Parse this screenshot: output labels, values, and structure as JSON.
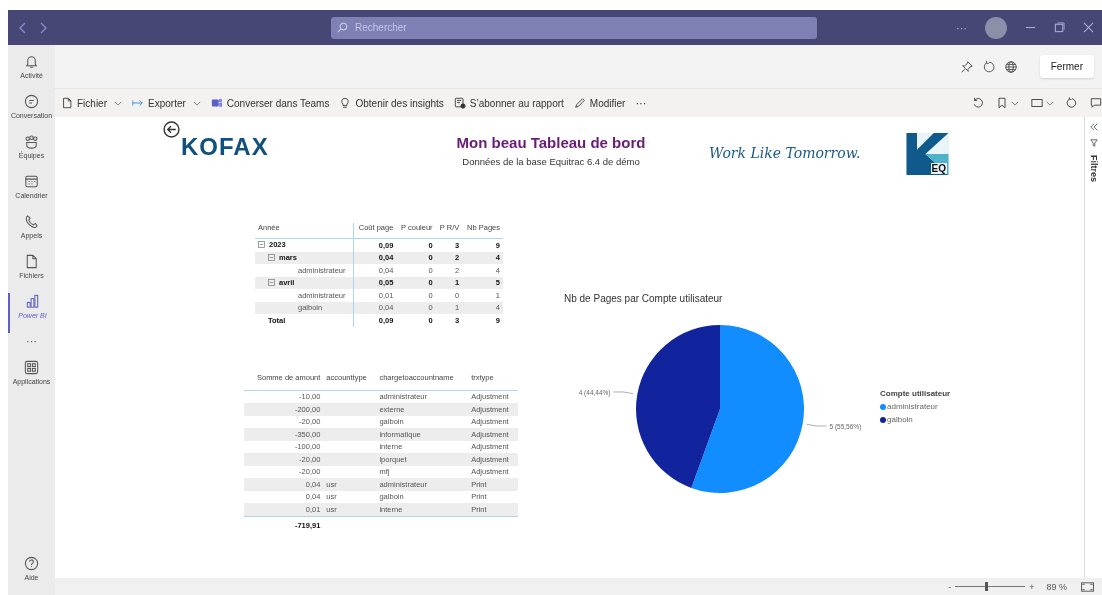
{
  "top_bar": {
    "search": {
      "placeholder": "Rechercher"
    },
    "more": "···"
  },
  "sidebar": {
    "items": [
      {
        "label": "Activité",
        "selected": false
      },
      {
        "label": "Conversation",
        "selected": false
      },
      {
        "label": "Équipes",
        "selected": false
      },
      {
        "label": "Calendrier",
        "selected": false
      },
      {
        "label": "Appels",
        "selected": false
      },
      {
        "label": "Fichiers",
        "selected": false
      },
      {
        "label": "Power BI",
        "selected": true
      }
    ],
    "more": "···",
    "apps": "Applications",
    "help": "Aide"
  },
  "header": {
    "close_button": "Fermer"
  },
  "toolbar": {
    "items": [
      {
        "label": "Fichier",
        "dropdown": true
      },
      {
        "label": "Exporter",
        "dropdown": true
      },
      {
        "label": "Converser dans Teams",
        "dropdown": false
      },
      {
        "label": "Obtenir des insights",
        "dropdown": false
      },
      {
        "label": "S’abonner au rapport",
        "dropdown": false
      },
      {
        "label": "Modifier",
        "dropdown": false
      }
    ],
    "more": "···"
  },
  "report": {
    "title": "Mon beau Tableau de bord",
    "subtitle": "Données de la base Equitrac 6.4 de démo",
    "logo": "KOFAX",
    "slogan": "Work Like Tomorrow.",
    "badge": "EQ",
    "matrix": {
      "columns": [
        "Année",
        "Coût page",
        "P couleur",
        "P R/V",
        "Nb Pages"
      ],
      "rows": [
        {
          "label": "2023",
          "values": [
            "0,09",
            "0",
            "3",
            "9"
          ],
          "expanded": true,
          "children": [
            {
              "label": "mars",
              "values": [
                "0,04",
                "0",
                "2",
                "4"
              ],
              "expanded": true,
              "children": [
                {
                  "label": "administrateur",
                  "values": [
                    "0,04",
                    "0",
                    "2",
                    "4"
                  ]
                }
              ]
            },
            {
              "label": "avril",
              "values": [
                "0,05",
                "0",
                "1",
                "5"
              ],
              "expanded": true,
              "children": [
                {
                  "label": "administrateur",
                  "values": [
                    "0,01",
                    "0",
                    "0",
                    "1"
                  ]
                },
                {
                  "label": "galboin",
                  "values": [
                    "0,04",
                    "0",
                    "1",
                    "4"
                  ]
                }
              ]
            }
          ]
        }
      ],
      "total": {
        "label": "Total",
        "values": [
          "0,09",
          "0",
          "3",
          "9"
        ]
      }
    },
    "table": {
      "columns": [
        "Somme de amount",
        "accounttype",
        "chargetoaccountname",
        "trxtype"
      ],
      "rows": [
        {
          "amount": "-10,00",
          "account": "administrateur",
          "trxtype": "Adjustment"
        },
        {
          "amount": "-200,00",
          "account": "externe",
          "trxtype": "Adjustment"
        },
        {
          "amount": "-20,00",
          "account": "galboin",
          "trxtype": "Adjustment"
        },
        {
          "amount": "-350,00",
          "account": "informatique",
          "trxtype": "Adjustment"
        },
        {
          "amount": "-100,00",
          "account": "interne",
          "trxtype": "Adjustment"
        },
        {
          "amount": "-20,00",
          "account": "lporquet",
          "trxtype": "Adjustment"
        },
        {
          "amount": "-20,00",
          "account": "mfj",
          "trxtype": "Adjustment"
        },
        {
          "amount": "0,04",
          "accounttype": "usr",
          "account": "administrateur",
          "trxtype": "Print"
        },
        {
          "amount": "0,04",
          "accounttype": "usr",
          "account": "galboin",
          "trxtype": "Print"
        },
        {
          "amount": "0,01",
          "accounttype": "usr",
          "account": "interne",
          "trxtype": "Print"
        }
      ],
      "total": "-719,91"
    },
    "pie": {
      "chart_data": {
        "type": "pie",
        "title": "Nb de Pages par Compte utilisateur",
        "categories": [
          "administrateur",
          "galboin"
        ],
        "values": [
          5,
          4
        ],
        "value_labels": [
          "5 (55,56%)",
          "4 (44,44%)"
        ]
      },
      "legend": {
        "title": "Compte utilisateur",
        "items": [
          {
            "color": "#118dff"
          },
          {
            "color": "#12239e"
          }
        ]
      }
    }
  },
  "filter_pane": {
    "label": "Filtres"
  },
  "status_bar": {
    "zoom": {
      "minus": "-",
      "plus": "+",
      "level": 0.44,
      "reading": "89 %"
    }
  }
}
